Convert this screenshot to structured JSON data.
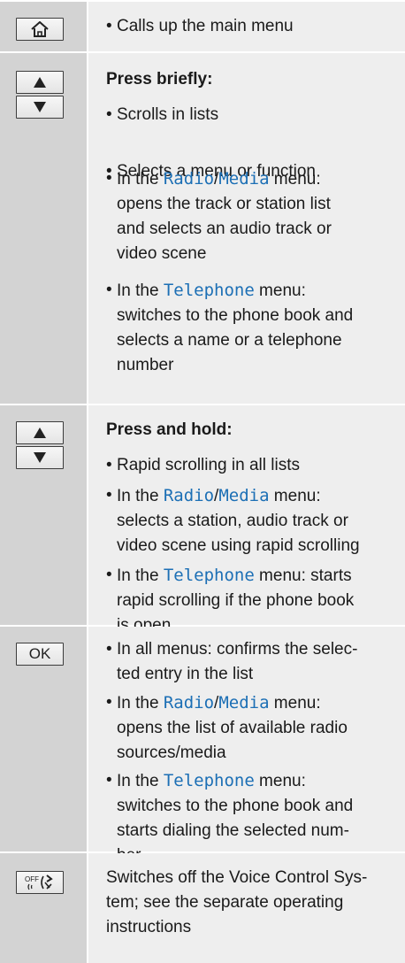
{
  "rows": [
    {
      "key": "home-key",
      "items": [
        {
          "type": "bullet",
          "text": "Calls up the main menu"
        }
      ]
    },
    {
      "key": "up-down-keys",
      "heading": "Press briefly:",
      "items": [
        {
          "text": "Scrolls in lists"
        },
        {
          "text": "Selects a menu or function"
        },
        {
          "prefix": "In the ",
          "m1": "Radio",
          "sep": "/",
          "m2": "Media",
          "suffix": " menu:",
          "line2": "opens the track or station list",
          "line3": "and selects an audio track or",
          "line4": "video scene"
        },
        {
          "prefix": "In the ",
          "m1": "Telephone",
          "suffix": " menu:",
          "line2": "switches to the phone book and",
          "line3": "selects a name or a telephone",
          "line4": "number"
        }
      ]
    },
    {
      "key": "up-down-keys",
      "heading": "Press and hold:",
      "items": [
        {
          "text": "Rapid scrolling in all lists"
        },
        {
          "prefix": "In the ",
          "m1": "Radio",
          "sep": "/",
          "m2": "Media",
          "suffix": " menu:",
          "line2": "selects a station, audio track or",
          "line3": "video scene using rapid scrolling"
        },
        {
          "prefix": "In the ",
          "m1": "Telephone",
          "suffix": " menu: starts",
          "line2": "rapid scrolling if the phone book",
          "line3": "is open"
        }
      ]
    },
    {
      "key": "ok-key",
      "key_label": "OK",
      "items": [
        {
          "line1": "In all menus: confirms the selec-",
          "line2": "ted entry in the list"
        },
        {
          "prefix": "In the ",
          "m1": "Radio",
          "sep": "/",
          "m2": "Media",
          "suffix": " menu:",
          "line2": "opens the list of available radio",
          "line3": "sources/media"
        },
        {
          "prefix": "In the ",
          "m1": "Telephone",
          "suffix": " menu:",
          "line2": "switches to the phone book and",
          "line3": "starts dialing the selected num-",
          "line4": "ber"
        }
      ]
    },
    {
      "key": "voice-off-key",
      "key_label": "OFF",
      "lines": [
        "Switches off the Voice Control Sys-",
        "tem; see the separate operating",
        "instructions"
      ]
    }
  ]
}
